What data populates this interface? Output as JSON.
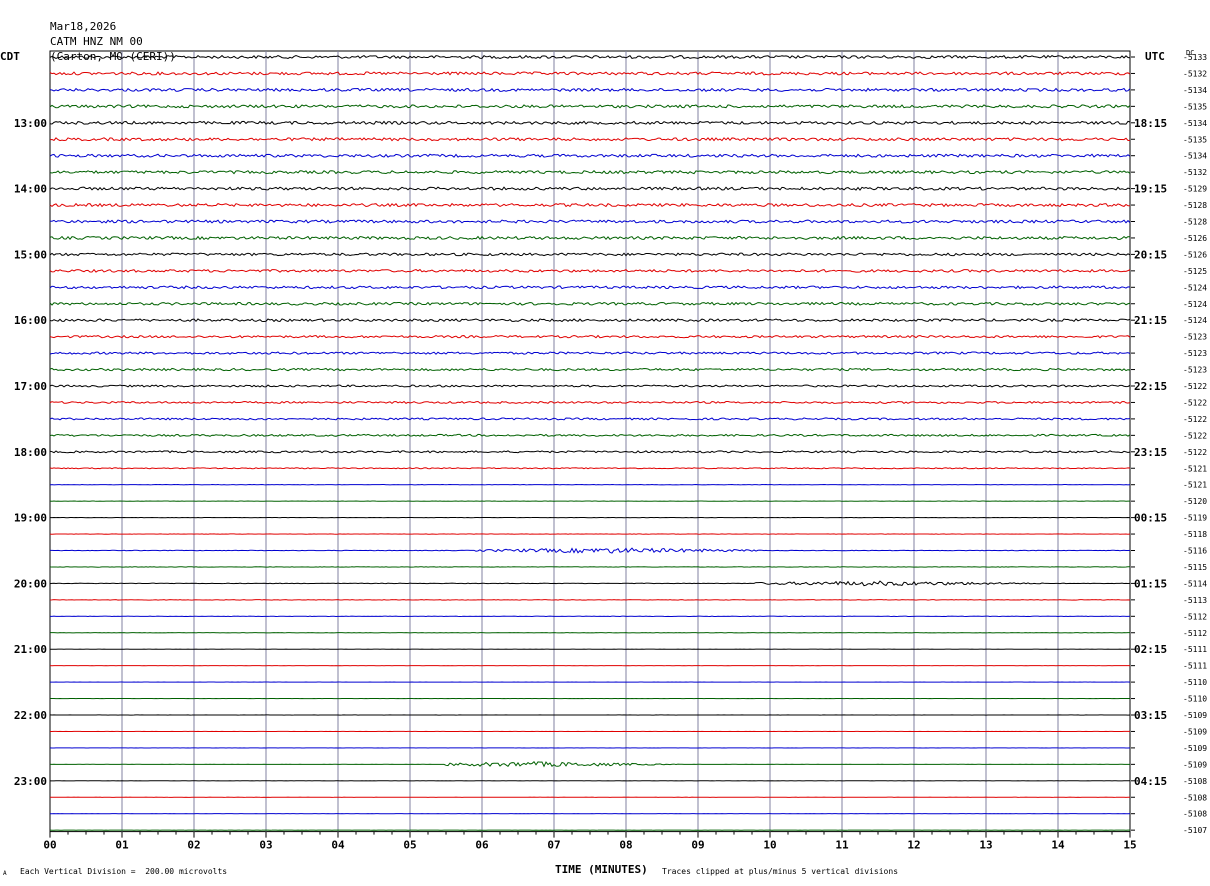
{
  "header": {
    "date": "Mar18,2026",
    "station": "CATM HNZ NM 00",
    "location": "(Carton, MO (CERI))"
  },
  "left_tz": "CDT",
  "right_tz": "UTC",
  "dc_label": "DC",
  "footer": {
    "scale": "Each Vertical Division =  200.00 microvolts",
    "clip": "Traces clipped at plus/minus 5 vertical divisions",
    "corner_mark": "A"
  },
  "colors": {
    "trace_cycle": [
      "#000000",
      "#e00000",
      "#0000d0",
      "#006000"
    ],
    "grid": "#8080a0"
  },
  "chart_data": {
    "type": "line",
    "title": "CATM HNZ NM 00",
    "xlabel": "TIME (MINUTES)",
    "xlim": [
      0,
      15
    ],
    "x_ticks": [
      "00",
      "01",
      "02",
      "03",
      "04",
      "05",
      "06",
      "07",
      "08",
      "09",
      "10",
      "11",
      "12",
      "13",
      "14",
      "15"
    ],
    "rows_per_hour": 4,
    "minutes_per_row": 15,
    "left_hour_labels": [
      "13:00",
      "14:00",
      "15:00",
      "16:00",
      "17:00",
      "18:00",
      "19:00",
      "20:00",
      "21:00",
      "22:00",
      "23:00"
    ],
    "right_hour_labels": [
      "18:15",
      "19:15",
      "20:15",
      "21:15",
      "22:15",
      "23:15",
      "00:15",
      "01:15",
      "02:15",
      "03:15",
      "04:15"
    ],
    "dc_offsets": [
      "-5133",
      "-5132",
      "-5134",
      "-5135",
      "-5134",
      "-5135",
      "-5134",
      "-5132",
      "-5129",
      "-5128",
      "-5128",
      "-5126",
      "-5126",
      "-5125",
      "-5124",
      "-5124",
      "-5124",
      "-5123",
      "-5123",
      "-5123",
      "-5122",
      "-5122",
      "-5122",
      "-5122",
      "-5122",
      "-5121",
      "-5121",
      "-5120",
      "-5119",
      "-5118",
      "-5116",
      "-5115",
      "-5114",
      "-5113",
      "-5112",
      "-5112",
      "-5111",
      "-5111",
      "-5110",
      "-5110",
      "-5109",
      "-5109",
      "-5109",
      "-5109",
      "-5108",
      "-5108",
      "-5108",
      "-5107"
    ],
    "row_noise_level": [
      0.9,
      0.9,
      0.9,
      0.9,
      0.9,
      0.9,
      0.9,
      0.9,
      0.9,
      0.9,
      0.9,
      0.9,
      0.8,
      0.8,
      0.8,
      0.8,
      0.8,
      0.7,
      0.7,
      0.7,
      0.6,
      0.6,
      0.6,
      0.6,
      0.6,
      0.3,
      0.1,
      0.1,
      0.1,
      0.1,
      0.15,
      0.15,
      0.15,
      0.15,
      0.1,
      0.1,
      0.05,
      0.05,
      0.05,
      0.05,
      0.05,
      0.05,
      0.05,
      0.05,
      0.05,
      0.05,
      0.05,
      0.05
    ],
    "events": [
      {
        "row": 30,
        "start_min": 5.9,
        "end_min": 9.9,
        "peak_min": 7.8,
        "amplitude": 2.5
      },
      {
        "row": 32,
        "start_min": 9.8,
        "end_min": 13.8,
        "peak_min": 11.5,
        "amplitude": 2.2
      },
      {
        "row": 43,
        "start_min": 5.5,
        "end_min": 9.0,
        "peak_min": 6.7,
        "amplitude": 2.6
      }
    ]
  }
}
